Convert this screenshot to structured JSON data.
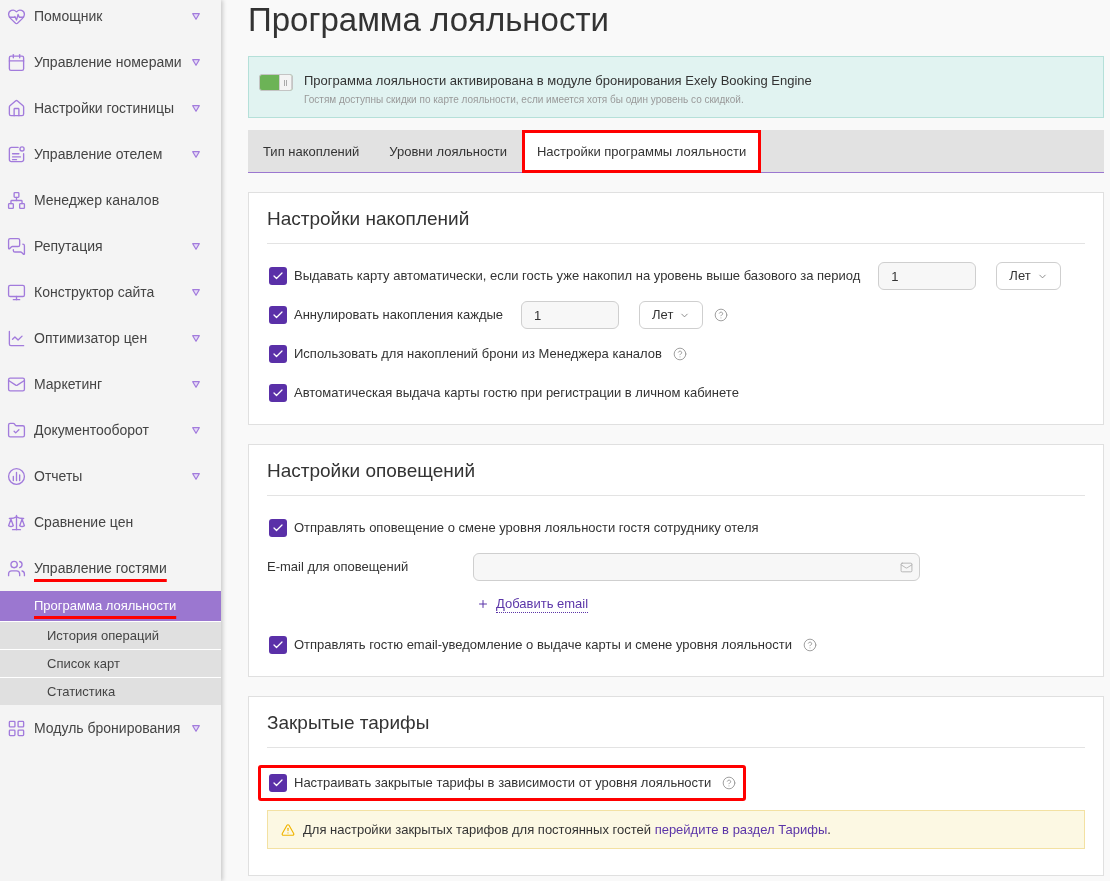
{
  "sidebar": {
    "items": [
      {
        "label": "Помощник",
        "expandable": true,
        "highlighted": false
      },
      {
        "label": "Управление номерами",
        "expandable": true,
        "highlighted": false
      },
      {
        "label": "Настройки гостиницы",
        "expandable": true,
        "highlighted": false
      },
      {
        "label": "Управление отелем",
        "expandable": true,
        "highlighted": false
      },
      {
        "label": "Менеджер каналов",
        "expandable": false,
        "highlighted": false
      },
      {
        "label": "Репутация",
        "expandable": true,
        "highlighted": false
      },
      {
        "label": "Конструктор сайта",
        "expandable": true,
        "highlighted": false
      },
      {
        "label": "Оптимизатор цен",
        "expandable": true,
        "highlighted": false
      },
      {
        "label": "Маркетинг",
        "expandable": true,
        "highlighted": false
      },
      {
        "label": "Документооборот",
        "expandable": true,
        "highlighted": false
      },
      {
        "label": "Отчеты",
        "expandable": true,
        "highlighted": false
      },
      {
        "label": "Сравнение цен",
        "expandable": false,
        "highlighted": false
      },
      {
        "label": "Управление гостями",
        "expandable": false,
        "highlighted": true,
        "children": [
          {
            "label": "Программа лояльности",
            "selected": true,
            "highlighted": true
          },
          {
            "label": "История операций",
            "selected": false,
            "highlighted": false
          },
          {
            "label": "Список карт",
            "selected": false,
            "highlighted": false
          },
          {
            "label": "Статистика",
            "selected": false,
            "highlighted": false
          }
        ]
      },
      {
        "label": "Модуль бронирования",
        "expandable": true,
        "highlighted": false
      }
    ]
  },
  "page": {
    "title": "Программа лояльности"
  },
  "banner": {
    "toggle_on": true,
    "title": "Программа лояльности активирована в модуле бронирования Exely Booking Engine",
    "note": "Гостям доступны скидки по карте лояльности, если имеется хотя бы один уровень со скидкой."
  },
  "tabs": [
    {
      "label": "Тип накоплений",
      "selected": false,
      "highlighted": false
    },
    {
      "label": "Уровни лояльности",
      "selected": false,
      "highlighted": false
    },
    {
      "label": "Настройки программы лояльности",
      "selected": true,
      "highlighted": true
    }
  ],
  "sections": [
    {
      "title": "Настройки накоплений",
      "rows": [
        {
          "kind": "checkbox",
          "label": "Выдавать карту автоматически, если гость уже накопил на уровень выше базового за период",
          "checked": true,
          "help": false,
          "highlighted": false,
          "number": "1",
          "unit": "Лет"
        },
        {
          "kind": "checkbox",
          "label": "Аннулировать накопления каждые",
          "checked": true,
          "help": true,
          "highlighted": false,
          "number": "1",
          "unit": "Лет"
        },
        {
          "kind": "checkbox",
          "label": "Использовать для накоплений брони из Менеджера каналов",
          "checked": true,
          "help": true,
          "highlighted": false
        },
        {
          "kind": "checkbox",
          "label": "Автоматическая выдача карты гостю при регистрации в личном кабинете",
          "checked": true,
          "help": false,
          "highlighted": false
        }
      ]
    },
    {
      "title": "Настройки оповещений",
      "rows": [
        {
          "kind": "checkbox",
          "label": "Отправлять оповещение о смене уровня лояльности гостя сотруднику отеля",
          "checked": true,
          "help": false,
          "highlighted": false
        },
        {
          "kind": "email",
          "label": "E-mail для оповещений",
          "add_link": "Добавить email"
        },
        {
          "kind": "checkbox",
          "label": "Отправлять гостю email-уведомление о выдаче карты и смене уровня лояльности",
          "checked": true,
          "help": true,
          "highlighted": false
        }
      ]
    },
    {
      "title": "Закрытые тарифы",
      "rows": [
        {
          "kind": "checkbox",
          "label": "Настраивать закрытые тарифы в зависимости от уровня лояльности",
          "checked": true,
          "help": true,
          "highlighted": true
        },
        {
          "kind": "warning",
          "text": "Для настройки закрытых тарифов для постоянных гостей",
          "link": "перейдите в раздел Тарифы",
          "suffix": "."
        }
      ]
    }
  ]
}
